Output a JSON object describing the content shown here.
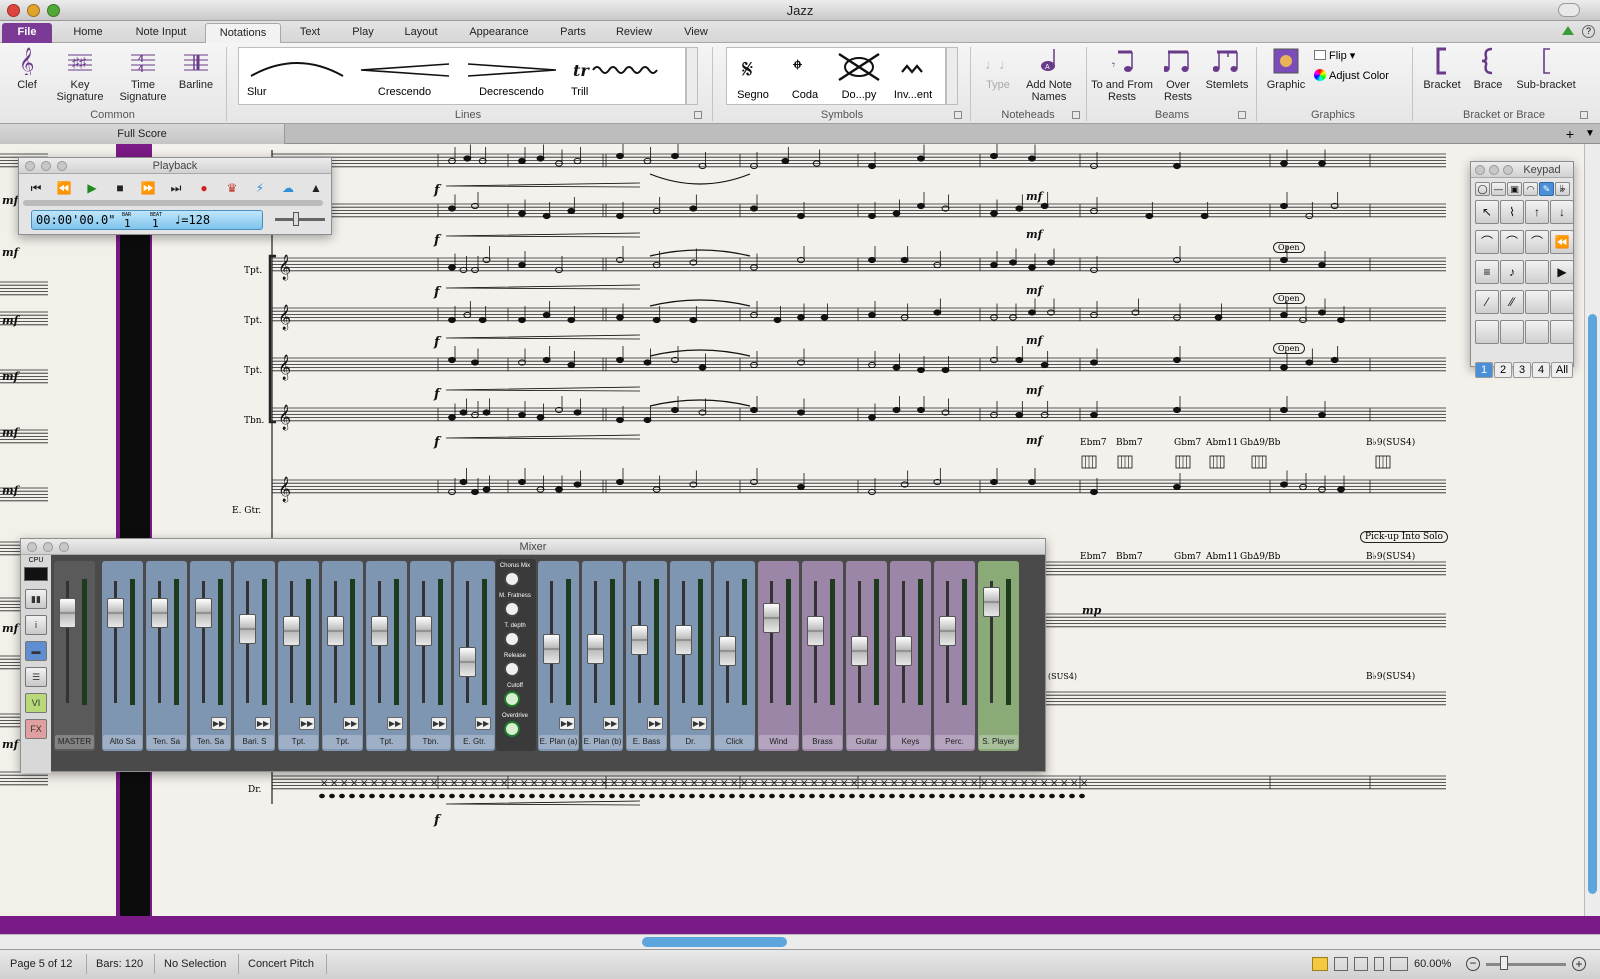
{
  "window": {
    "title": "Jazz"
  },
  "tabs": [
    {
      "label": "File"
    },
    {
      "label": "Home"
    },
    {
      "label": "Note Input"
    },
    {
      "label": "Notations"
    },
    {
      "label": "Text"
    },
    {
      "label": "Play"
    },
    {
      "label": "Layout"
    },
    {
      "label": "Appearance"
    },
    {
      "label": "Parts"
    },
    {
      "label": "Review"
    },
    {
      "label": "View"
    }
  ],
  "ribbon": {
    "common": {
      "clef": "Clef",
      "key_signature": "Key Signature",
      "time_signature": "Time Signature",
      "barline": "Barline",
      "group": "Common"
    },
    "lines": {
      "slur": "Slur",
      "crescendo": "Crescendo",
      "decrescendo": "Decrescendo",
      "trill": "Trill",
      "group": "Lines"
    },
    "symbols": {
      "segno": "Segno",
      "coda": "Coda",
      "dopy": "Do...py",
      "inverted": "Inv...ent",
      "group": "Symbols"
    },
    "noteheads": {
      "type": "Type",
      "add_note_names": "Add Note Names",
      "group": "Noteheads"
    },
    "beams": {
      "to_and_from_rests": "To and From Rests",
      "over_rests": "Over Rests",
      "stemlets": "Stemlets",
      "group": "Beams"
    },
    "graphics": {
      "graphic": "Graphic",
      "flip": "Flip",
      "adjust_color": "Adjust Color",
      "group": "Graphics"
    },
    "bracket": {
      "bracket": "Bracket",
      "brace": "Brace",
      "sub_bracket": "Sub-bracket",
      "group": "Bracket or Brace"
    }
  },
  "document_tab": "Full Score",
  "playback": {
    "title": "Playback",
    "time": "00:00'00.0\"",
    "bar_label": "BAR",
    "bar": "1",
    "beat_label": "BEAT",
    "beat": "1",
    "tempo": "♩=128"
  },
  "mixer": {
    "title": "Mixer",
    "cpu_label": "CPU",
    "side_buttons": [
      "VI",
      "FX"
    ],
    "fx_knobs": [
      "Chorus Mix",
      "M. Fratness",
      "T. depth",
      "Release",
      "Cutoff",
      "Overdrive"
    ],
    "master": {
      "label": "MASTER",
      "level": 0.85
    },
    "strips": [
      {
        "label": "Alto Sa",
        "level": 0.85,
        "group": "staff"
      },
      {
        "label": "Ten. Sa",
        "level": 0.85,
        "group": "staff"
      },
      {
        "label": "Ten. Sa",
        "level": 0.85,
        "group": "staff"
      },
      {
        "label": "Bari. S",
        "level": 0.7,
        "group": "staff"
      },
      {
        "label": "Tpt.",
        "level": 0.68,
        "group": "staff"
      },
      {
        "label": "Tpt.",
        "level": 0.68,
        "group": "staff"
      },
      {
        "label": "Tpt.",
        "level": 0.68,
        "group": "staff"
      },
      {
        "label": "Tbn.",
        "level": 0.68,
        "group": "staff"
      },
      {
        "label": "E. Gtr.",
        "level": 0.4,
        "group": "staff"
      },
      {
        "label": "E. Plan (a)",
        "level": 0.52,
        "group": "staff"
      },
      {
        "label": "E. Plan (b)",
        "level": 0.52,
        "group": "staff"
      },
      {
        "label": "E. Bass",
        "level": 0.6,
        "group": "staff"
      },
      {
        "label": "Dr.",
        "level": 0.6,
        "group": "staff"
      },
      {
        "label": "Click",
        "level": 0.5,
        "group": "staff"
      },
      {
        "label": "Wind",
        "level": 0.8,
        "group": "bus"
      },
      {
        "label": "Brass",
        "level": 0.68,
        "group": "bus"
      },
      {
        "label": "Guitar",
        "level": 0.5,
        "group": "bus"
      },
      {
        "label": "Keys",
        "level": 0.5,
        "group": "bus"
      },
      {
        "label": "Perc.",
        "level": 0.68,
        "group": "bus"
      },
      {
        "label": "S. Player",
        "level": 0.95,
        "group": "player"
      }
    ]
  },
  "keypad": {
    "title": "Keypad",
    "layouts": [
      "1",
      "2",
      "3",
      "4",
      "All"
    ],
    "selected_layout": "1"
  },
  "score": {
    "instruments": [
      "Tpt.",
      "Tpt.",
      "Tpt.",
      "Tbn.",
      "E. Gtr.",
      "Dr."
    ],
    "dynamics_f": "f",
    "dynamics_mf": "mf",
    "dynamics_mp": "mp",
    "open": "Open",
    "pickup": "Pick-up Into Solo",
    "chords_top": [
      "Ebm7",
      "Bbm7",
      "Gbm7",
      "Abm11",
      "Gb∆9/Bb",
      "B♭9(SUS4)"
    ],
    "chords_piano": [
      "Ebm7",
      "Bbm7",
      "Gbm7",
      "Abm11",
      "Gb∆9/Bb",
      "B♭9(SUS4)"
    ],
    "chord_bass": "B♭9(SUS4)",
    "sus_fragment": "(SUS4)"
  },
  "status": {
    "page": "Page 5 of 12",
    "bars": "Bars: 120",
    "selection": "No Selection",
    "pitch": "Concert Pitch",
    "zoom": "60.00%"
  },
  "colors": {
    "file_tab": "#7a3a96",
    "page_gap": "#7a1a86",
    "scroll_thumb": "#5da6dd",
    "strip_staff": "#7f96b3",
    "strip_bus": "#9c86a8",
    "strip_player": "#8aaa78",
    "selected": "#4a8fd8"
  }
}
